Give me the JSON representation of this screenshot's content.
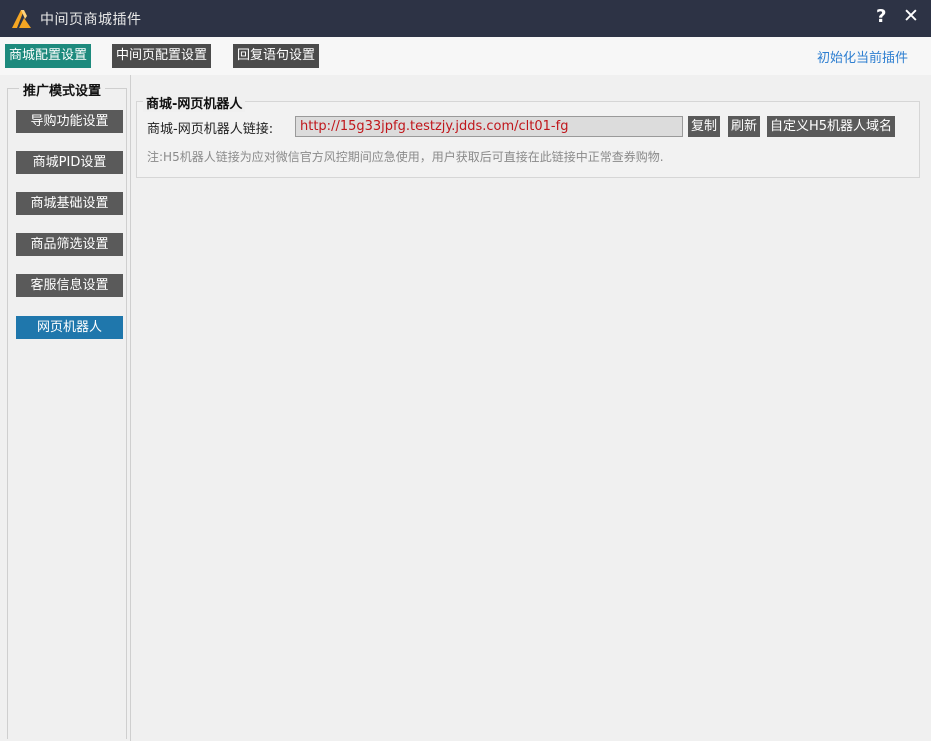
{
  "window": {
    "title": "中间页商城插件",
    "help_label": "?",
    "close_label": "✕",
    "logo_color": "#f5a623"
  },
  "top_tabs": [
    {
      "label": "商城配置设置",
      "active": true
    },
    {
      "label": "中间页配置设置",
      "active": false
    },
    {
      "label": "回复语句设置",
      "active": false
    }
  ],
  "init_link": "初始化当前插件",
  "sidebar": {
    "legend": "推广模式设置",
    "items": [
      {
        "label": "导购功能设置",
        "active": false
      },
      {
        "label": "商城PID设置",
        "active": false
      },
      {
        "label": "商城基础设置",
        "active": false
      },
      {
        "label": "商品筛选设置",
        "active": false
      },
      {
        "label": "客服信息设置",
        "active": false
      },
      {
        "label": "网页机器人",
        "active": true
      }
    ]
  },
  "robot_panel": {
    "legend": "商城-网页机器人",
    "link_label": "商城-网页机器人链接:",
    "link_value": "http://15g33jpfg.testzjy.jdds.com/clt01-fg",
    "copy_label": "复制",
    "refresh_label": "刷新",
    "custom_domain_label": "自定义H5机器人域名",
    "note": "注:H5机器人链接为应对微信官方风控期间应急使用，用户获取后可直接在此链接中正常查券购物."
  },
  "colors": {
    "titlebar_bg": "#2d3345",
    "tab_active": "#1d8a7d",
    "button_gray": "#5a5a5a",
    "sidebar_active": "#1f77ac",
    "link_text": "#c0161b",
    "init_link": "#2e7fd1"
  }
}
